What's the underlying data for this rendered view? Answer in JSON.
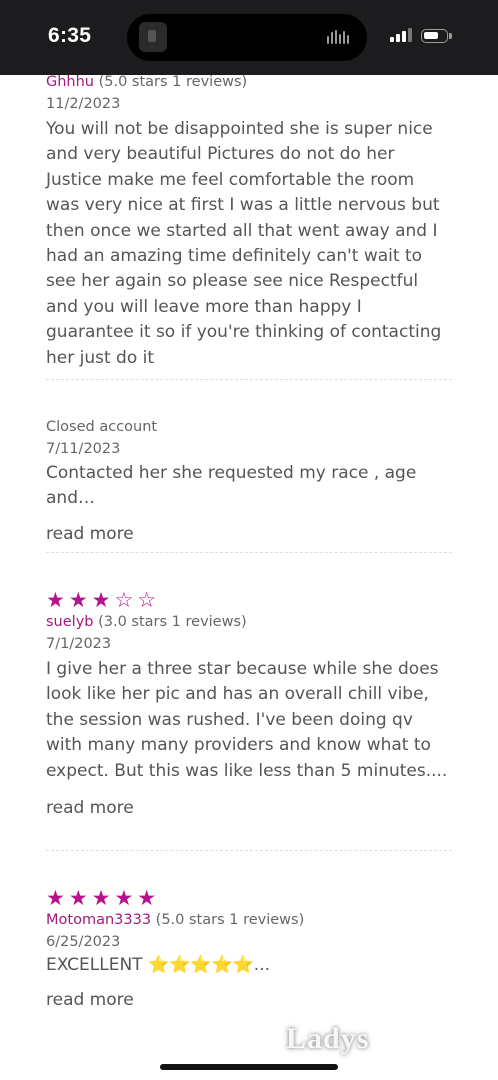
{
  "status_bar": {
    "time": "6:35"
  },
  "reviews": [
    {
      "name": "Ghhhu",
      "meta": "(5.0 stars 1 reviews)",
      "date": "11/2/2023",
      "body": "You will not be disappointed she is super nice and very beautiful Pictures do not do her Justice make me feel comfortable the room was very nice at first I was a little nervous but then once we started all that went away and I had an amazing time definitely can't wait to see her again so please see nice Respectful and you will leave more than happy I guarantee it so if you're thinking of contacting her just do it"
    },
    {
      "name": "Closed account",
      "date": "7/11/2023",
      "body": "Contacted her she requested my race , age and…",
      "read_more": "read more"
    },
    {
      "stars": "★★★☆☆",
      "rating": 3,
      "name": "suelyb",
      "meta": "(3.0 stars 1 reviews)",
      "date": "7/1/2023",
      "body": "I give her a three star because while she does look like her pic and has an overall chill vibe, the session was rushed. I've been doing qv with many many providers and know what to expect. But this was like less than 5 minutes....",
      "read_more": "read more"
    },
    {
      "stars": "★★★★★",
      "rating": 5,
      "name": "Motoman3333",
      "meta": "(5.0 stars 1 reviews)",
      "date": "6/25/2023",
      "body": "EXCELLENT",
      "body_emoji": "⭐⭐⭐⭐⭐",
      "body_ellipsis": "...",
      "read_more": "read more"
    }
  ],
  "watermark": "Ladys",
  "colors": {
    "accent": "#a3197d",
    "star": "#b8118e",
    "text": "#555555"
  }
}
